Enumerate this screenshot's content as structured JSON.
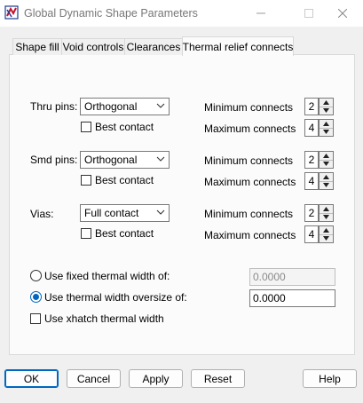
{
  "window": {
    "title": "Global Dynamic Shape Parameters",
    "minimize_icon": "minimize-icon",
    "maximize_icon": "maximize-icon",
    "close_icon": "close-icon"
  },
  "tabs": [
    {
      "label": "Shape fill"
    },
    {
      "label": "Void controls"
    },
    {
      "label": "Clearances"
    },
    {
      "label": "Thermal relief connects",
      "active": true
    }
  ],
  "groups": {
    "thru": {
      "label": "Thru pins:",
      "connect_type": "Orthogonal",
      "best_contact": "Best contact",
      "best_contact_checked": false,
      "min_label": "Minimum connects",
      "min_value": "2",
      "max_label": "Maximum connects",
      "max_value": "4"
    },
    "smd": {
      "label": "Smd pins:",
      "connect_type": "Orthogonal",
      "best_contact": "Best contact",
      "best_contact_checked": false,
      "min_label": "Minimum connects",
      "min_value": "2",
      "max_label": "Maximum connects",
      "max_value": "4"
    },
    "vias": {
      "label": "Vias:",
      "connect_type": "Full contact",
      "best_contact": "Best contact",
      "best_contact_checked": false,
      "min_label": "Minimum connects",
      "min_value": "2",
      "max_label": "Maximum connects",
      "max_value": "4"
    }
  },
  "width_options": {
    "fixed": {
      "label": "Use fixed thermal width of:",
      "value": "0.0000",
      "selected": false,
      "enabled": false
    },
    "oversize": {
      "label": "Use thermal width oversize of:",
      "value": "0.0000",
      "selected": true,
      "enabled": true
    },
    "xhatch": {
      "label": "Use xhatch thermal width",
      "checked": false
    }
  },
  "buttons": {
    "ok": "OK",
    "cancel": "Cancel",
    "apply": "Apply",
    "reset": "Reset",
    "help": "Help"
  },
  "colors": {
    "accent": "#0067c0",
    "window_bg": "#f0f0f0",
    "panel_bg": "#fbfbfb"
  }
}
